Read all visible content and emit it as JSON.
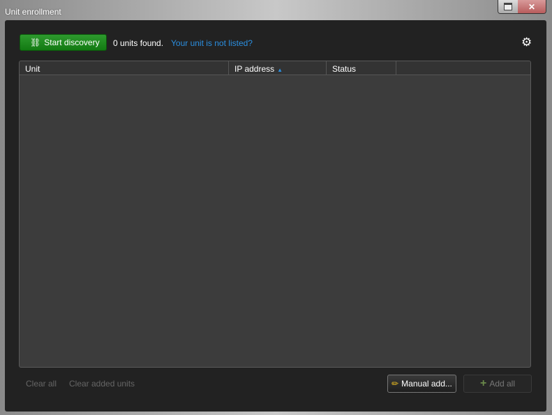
{
  "window": {
    "title": "Unit enrollment"
  },
  "toolbar": {
    "start_label": "Start discovery",
    "found_text": "0 units found.",
    "not_listed_link": "Your unit is not listed?"
  },
  "table": {
    "columns": [
      "Unit",
      "IP address",
      "Status"
    ],
    "sort_column": "IP address",
    "sort_direction": "ascending",
    "rows": []
  },
  "footer": {
    "clear_all": "Clear all",
    "clear_added": "Clear added units",
    "manual_add": "Manual add...",
    "add_all": "Add all"
  }
}
